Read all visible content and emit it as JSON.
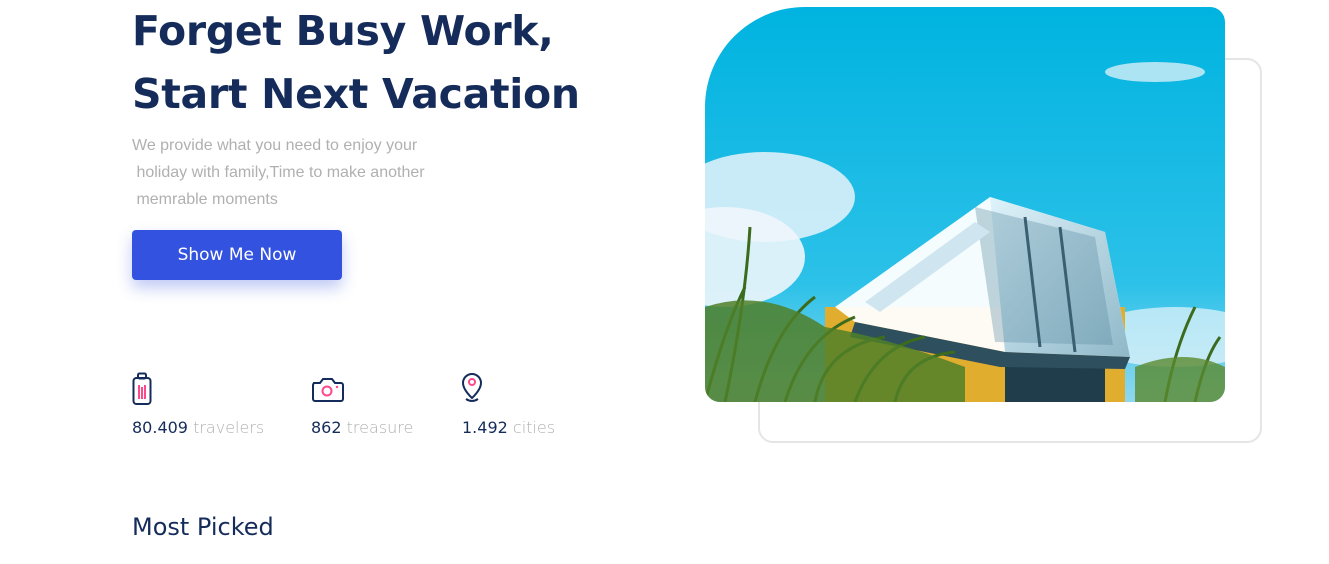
{
  "hero": {
    "headline_line1": "Forget  Busy Work,",
    "headline_line2": "Start  Next Vacation",
    "subtext_line1": "We provide what you need to enjoy your",
    "subtext_line2": " holiday with family,Time to make another",
    "subtext_line3": " memrable moments",
    "cta_label": "Show Me Now",
    "image_alt": "Modern glass house against blue sky"
  },
  "stats": [
    {
      "icon": "suitcase-icon",
      "number": "80.409",
      "unit": "travelers"
    },
    {
      "icon": "camera-icon",
      "number": "862",
      "unit": "treasure"
    },
    {
      "icon": "map-pin-icon",
      "number": "1.492",
      "unit": "cities"
    }
  ],
  "sections": {
    "most_picked_title": "Most Picked"
  },
  "colors": {
    "primary": "#3252df",
    "heading": "#152c5b",
    "muted": "#b0b0b0",
    "accent": "#ff498b"
  }
}
